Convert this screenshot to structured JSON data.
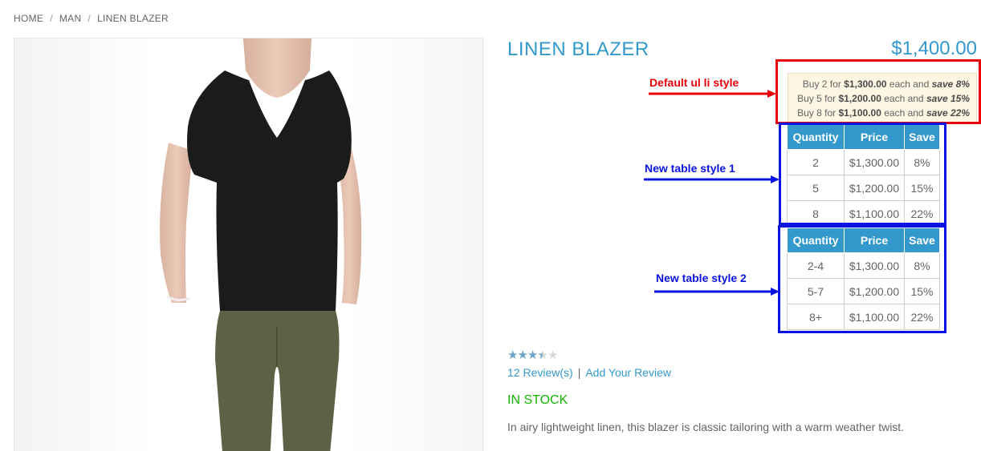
{
  "breadcrumb": {
    "items": [
      "HOME",
      "MAN",
      "LINEN BLAZER"
    ],
    "separator": "/"
  },
  "product": {
    "name": "LINEN BLAZER",
    "price": "$1,400.00",
    "rating_fraction": 0.7,
    "reviews_link": "12 Review(s)",
    "add_review_link": "Add Your Review",
    "links_separator": "|",
    "stock": "IN STOCK",
    "description": "In airy lightweight linen, this blazer is classic tailoring with a warm weather twist."
  },
  "tier_list": [
    {
      "prefix": "Buy 2 for",
      "price": "$1,300.00",
      "middle": "each and",
      "save": "save 8%"
    },
    {
      "prefix": "Buy 5 for",
      "price": "$1,200.00",
      "middle": "each and",
      "save": "save 15%"
    },
    {
      "prefix": "Buy 8 for",
      "price": "$1,100.00",
      "middle": "each and",
      "save": "save 22%"
    }
  ],
  "table_style_1": {
    "headers": [
      "Quantity",
      "Price",
      "Save"
    ],
    "rows": [
      [
        "2",
        "$1,300.00",
        "8%"
      ],
      [
        "5",
        "$1,200.00",
        "15%"
      ],
      [
        "8",
        "$1,100.00",
        "22%"
      ]
    ]
  },
  "table_style_2": {
    "headers": [
      "Quantity",
      "Price",
      "Save"
    ],
    "rows": [
      [
        "2-4",
        "$1,300.00",
        "8%"
      ],
      [
        "5-7",
        "$1,200.00",
        "15%"
      ],
      [
        "8+",
        "$1,100.00",
        "22%"
      ]
    ]
  },
  "annotations": {
    "default_label": "Default ul li style",
    "table1_label": "New table style 1",
    "table2_label": "New table style 2",
    "red_color": "#e8000b",
    "blue_color": "#0a14e0"
  },
  "colors": {
    "accent": "#3399cc",
    "stock": "#11b400"
  }
}
